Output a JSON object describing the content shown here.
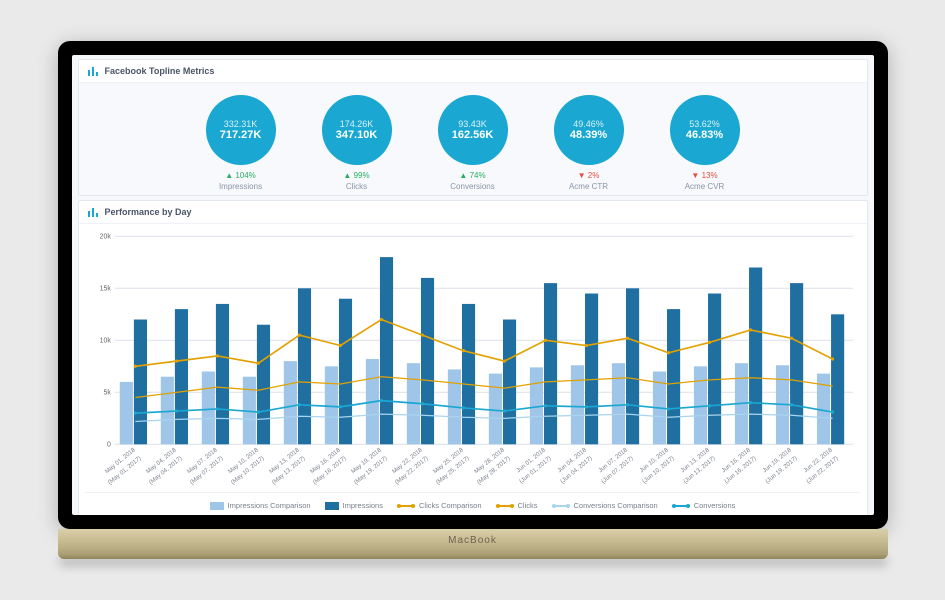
{
  "device_label": "MacBook",
  "topline": {
    "title": "Facebook Topline Metrics"
  },
  "kpis": [
    {
      "compare": "332.31K",
      "current": "717.27K",
      "delta": "▲ 104%",
      "dir": "up",
      "label": "Impressions"
    },
    {
      "compare": "174.26K",
      "current": "347.10K",
      "delta": "▲ 99%",
      "dir": "up",
      "label": "Clicks"
    },
    {
      "compare": "93.43K",
      "current": "162.56K",
      "delta": "▲ 74%",
      "dir": "up",
      "label": "Conversions"
    },
    {
      "compare": "49.46%",
      "current": "48.39%",
      "delta": "▼ 2%",
      "dir": "dn",
      "label": "Acme CTR"
    },
    {
      "compare": "53.62%",
      "current": "46.83%",
      "delta": "▼ 13%",
      "dir": "dn",
      "label": "Acme CVR"
    }
  ],
  "perf": {
    "title": "Performance by Day"
  },
  "legend": {
    "impC": "Impressions Comparison",
    "imp": "Impressions",
    "clkC": "Clicks Comparison",
    "clk": "Clicks",
    "cnvC": "Conversions Comparison",
    "cnv": "Conversions"
  },
  "chart_data": {
    "type": "bar+line",
    "ylabel": "",
    "ylim": [
      0,
      20000
    ],
    "yticks": [
      0,
      5000,
      10000,
      15000,
      20000
    ],
    "ytick_labels": [
      "0",
      "5k",
      "10k",
      "15k",
      "20k"
    ],
    "categories": [
      "May 01, 2018",
      "May 04, 2018",
      "May 07, 2018",
      "May 10, 2018",
      "May 13, 2018",
      "May 16, 2018",
      "May 19, 2018",
      "May 22, 2018",
      "May 25, 2018",
      "May 28, 2018",
      "Jun 01, 2018",
      "Jun 04, 2018",
      "Jun 07, 2018",
      "Jun 10, 2018",
      "Jun 13, 2018",
      "Jun 16, 2018",
      "Jun 19, 2018",
      "Jun 22, 2018"
    ],
    "categories_compare": [
      "(May 01, 2017)",
      "(May 04, 2017)",
      "(May 07, 2017)",
      "(May 10, 2017)",
      "(May 13, 2017)",
      "(May 16, 2017)",
      "(May 19, 2017)",
      "(May 22, 2017)",
      "(May 25, 2017)",
      "(May 28, 2017)",
      "(Jun 01, 2017)",
      "(Jun 04, 2017)",
      "(Jun 07, 2017)",
      "(Jun 10, 2017)",
      "(Jun 13, 2017)",
      "(Jun 16, 2017)",
      "(Jun 19, 2017)",
      "(Jun 22, 2017)"
    ],
    "series": [
      {
        "name": "Impressions Comparison",
        "kind": "bar",
        "color": "#9fc5e8",
        "values": [
          6000,
          6500,
          7000,
          6500,
          8000,
          7500,
          8200,
          7800,
          7200,
          6800,
          7400,
          7600,
          7800,
          7000,
          7500,
          7800,
          7600,
          6800
        ]
      },
      {
        "name": "Impressions",
        "kind": "bar",
        "color": "#1f6fa1",
        "values": [
          12000,
          13000,
          13500,
          11500,
          15000,
          14000,
          18000,
          16000,
          13500,
          12000,
          15500,
          14500,
          15000,
          13000,
          14500,
          17000,
          15500,
          12500
        ]
      },
      {
        "name": "Clicks Comparison",
        "kind": "line",
        "color": "#e2a100",
        "values": [
          4500,
          5000,
          5500,
          5200,
          6000,
          5800,
          6500,
          6200,
          5800,
          5400,
          6000,
          6200,
          6400,
          5800,
          6200,
          6400,
          6200,
          5600
        ]
      },
      {
        "name": "Clicks",
        "kind": "line",
        "color": "#e2a100",
        "values": [
          7500,
          8000,
          8500,
          7800,
          10500,
          9500,
          12000,
          10500,
          9000,
          8000,
          10000,
          9500,
          10200,
          8800,
          9800,
          11000,
          10200,
          8200
        ]
      },
      {
        "name": "Conversions Comparison",
        "kind": "line",
        "color": "#a9d4ee",
        "values": [
          2200,
          2400,
          2500,
          2400,
          2700,
          2600,
          2900,
          2800,
          2600,
          2500,
          2700,
          2800,
          2900,
          2600,
          2800,
          2900,
          2800,
          2500
        ]
      },
      {
        "name": "Conversions",
        "kind": "line",
        "color": "#1aa7d1",
        "values": [
          3000,
          3200,
          3400,
          3100,
          3800,
          3600,
          4200,
          3900,
          3500,
          3200,
          3700,
          3600,
          3800,
          3400,
          3700,
          4000,
          3800,
          3100
        ]
      }
    ]
  }
}
